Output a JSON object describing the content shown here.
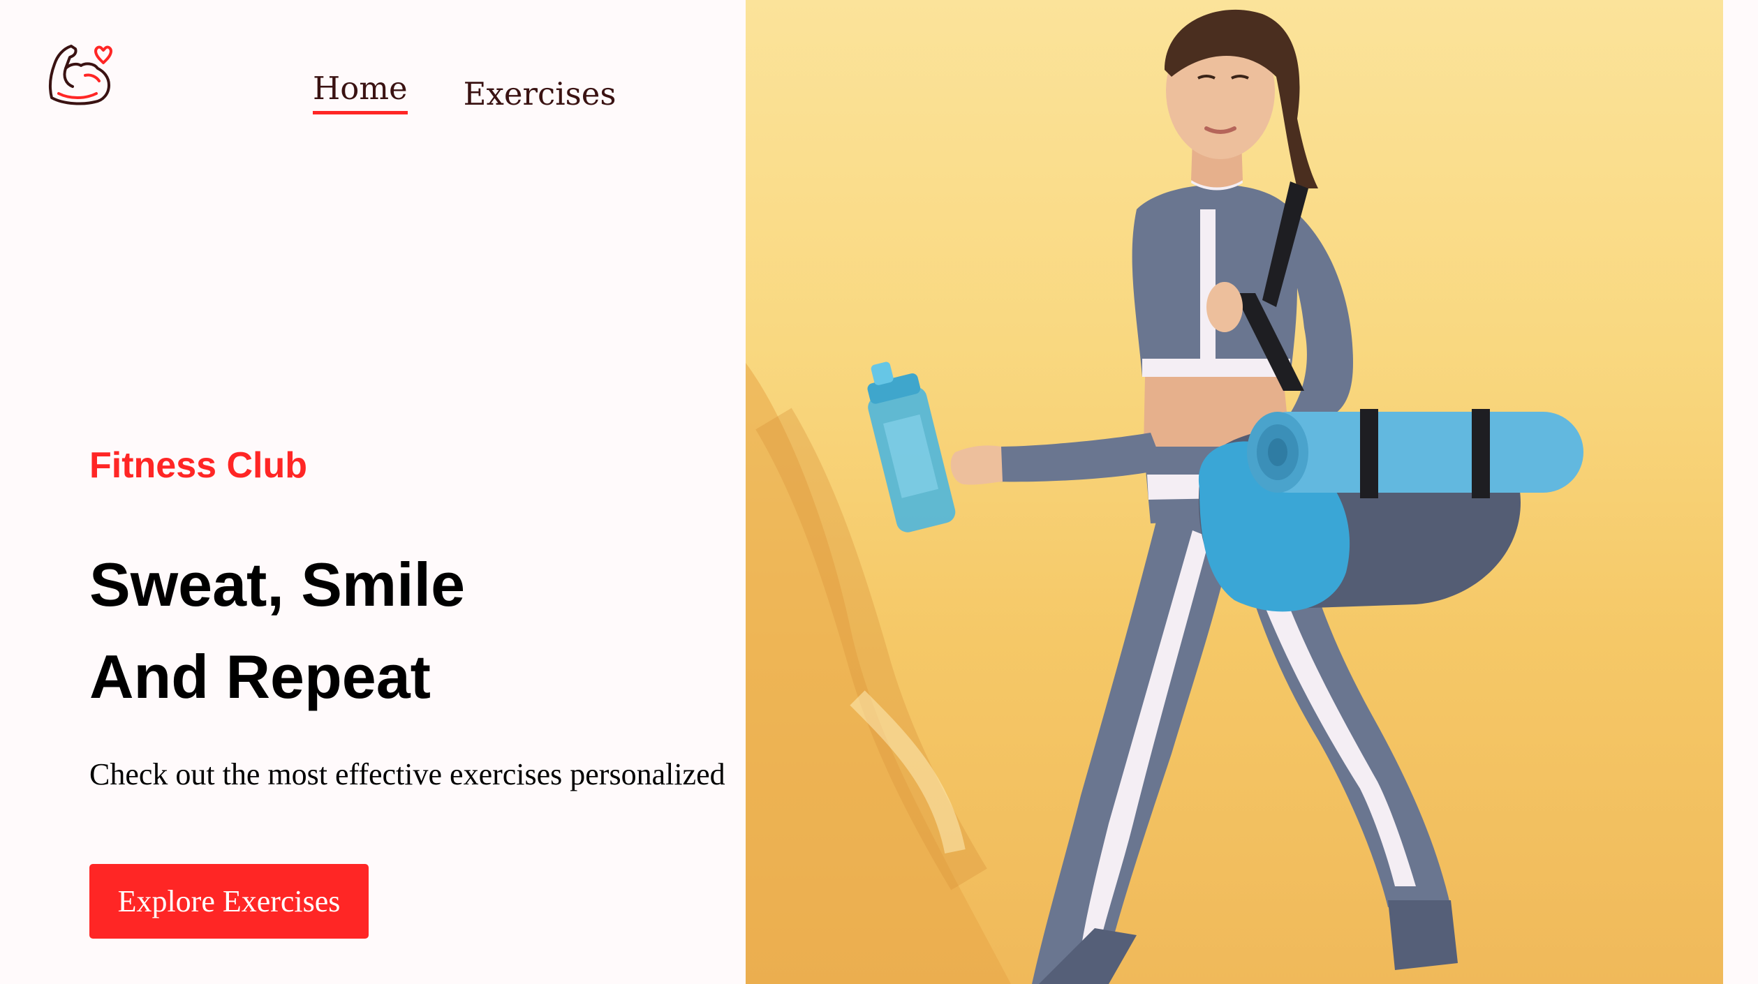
{
  "nav": {
    "logo_icon": "flexed-arm-heart-icon",
    "links": [
      {
        "label": "Home",
        "active": true
      },
      {
        "label": "Exercises",
        "active": false
      }
    ]
  },
  "hero": {
    "eyebrow": "Fitness Club",
    "title_line1": "Sweat, Smile",
    "title_line2": "And Repeat",
    "description": "Check out the most effective exercises personalized",
    "cta_label": "Explore Exercises",
    "image_icon": "woman-with-gym-bag-and-yoga-mat-photo"
  },
  "colors": {
    "accent": "#ff2625",
    "background": "#fffafb",
    "nav_text": "#3a1212",
    "photo_backdrop": "#f9d880"
  }
}
